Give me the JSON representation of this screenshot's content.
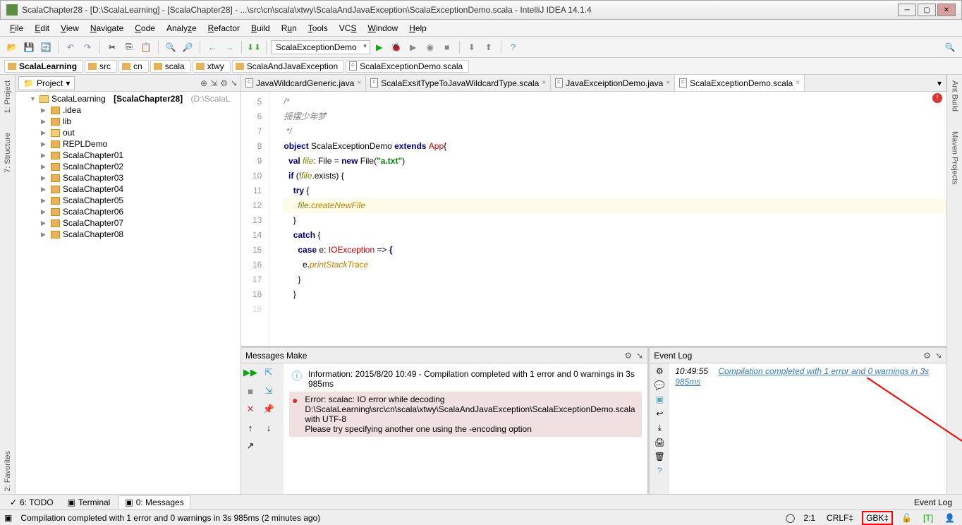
{
  "window": {
    "title": "ScalaChapter28 - [D:\\ScalaLearning] - [ScalaChapter28] - ...\\src\\cn\\scala\\xtwy\\ScalaAndJavaException\\ScalaExceptionDemo.scala - IntelliJ IDEA 14.1.4"
  },
  "menu": {
    "file": "File",
    "edit": "Edit",
    "view": "View",
    "navigate": "Navigate",
    "code": "Code",
    "analyze": "Analyze",
    "refactor": "Refactor",
    "build": "Build",
    "run": "Run",
    "tools": "Tools",
    "vcs": "VCS",
    "window": "Window",
    "help": "Help"
  },
  "toolbar": {
    "run_config": "ScalaExceptionDemo"
  },
  "breadcrumb": [
    "ScalaLearning",
    "src",
    "cn",
    "scala",
    "xtwy",
    "ScalaAndJavaException",
    "ScalaExceptionDemo.scala"
  ],
  "left_rail": {
    "project": "1: Project",
    "structure": "7: Structure",
    "favorites": "2: Favorites"
  },
  "right_rail": {
    "ant": "Ant Build",
    "maven": "Maven Projects"
  },
  "project_panel": {
    "header": "Project",
    "root": "ScalaLearning",
    "root_module": "[ScalaChapter28]",
    "root_path": "(D:\\ScalaL",
    "items": [
      ".idea",
      "lib",
      "out",
      "REPLDemo",
      "ScalaChapter01",
      "ScalaChapter02",
      "ScalaChapter03",
      "ScalaChapter04",
      "ScalaChapter05",
      "ScalaChapter06",
      "ScalaChapter07",
      "ScalaChapter08"
    ]
  },
  "editor_tabs": [
    "JavaWildcardGeneric.java",
    "ScalaExsitTypeToJavaWildcardType.scala",
    "JavaExceiptionDemo.java",
    "ScalaExceptionDemo.scala"
  ],
  "code_lines": {
    "start": 5,
    "content": [
      {
        "t": "com",
        "txt": "/*"
      },
      {
        "t": "com",
        "txt": "摇摆少年梦"
      },
      {
        "t": "com",
        "txt": " */"
      },
      {
        "t": "obj",
        "parts": [
          "object ",
          "ScalaExceptionDemo ",
          "extends ",
          "App",
          "{"
        ]
      },
      {
        "t": "val",
        "parts": [
          "  ",
          "val ",
          "file",
          ": File = ",
          "new ",
          "File(",
          "\"a.txt\"",
          ")"
        ]
      },
      {
        "t": "if",
        "parts": [
          "  ",
          "if ",
          "(!",
          "file",
          ".exists) {"
        ]
      },
      {
        "t": "try",
        "parts": [
          "    ",
          "try ",
          "{"
        ]
      },
      {
        "t": "call",
        "parts": [
          "      ",
          "file",
          ".",
          "createNewFile"
        ],
        "hl": true
      },
      {
        "t": "close",
        "txt": "    }"
      },
      {
        "t": "catch",
        "parts": [
          "    ",
          "catch ",
          "{"
        ]
      },
      {
        "t": "case",
        "parts": [
          "      ",
          "case ",
          "e: ",
          "IOException",
          " => ",
          "{"
        ]
      },
      {
        "t": "print",
        "parts": [
          "        e.",
          "printStackTrace"
        ]
      },
      {
        "t": "close",
        "txt": "      }"
      },
      {
        "t": "close",
        "txt": "    }"
      }
    ]
  },
  "messages": {
    "title": "Messages Make",
    "info": "Information: 2015/8/20 10:49 - Compilation completed with 1 error and 0 warnings in 3s 985ms",
    "error": "Error: scalac: IO error while decoding D:\\ScalaLearning\\src\\cn\\scala\\xtwy\\ScalaAndJavaException\\ScalaExceptionDemo.scala with UTF-8\nPlease try specifying another one using the -encoding option"
  },
  "eventlog": {
    "title": "Event Log",
    "time": "10:49:55",
    "link": "Compilation completed with 1 error and 0 warnings in 3s 985ms"
  },
  "bottom_tabs": {
    "todo": "6: TODO",
    "terminal": "Terminal",
    "messages": "0: Messages",
    "eventlog": "Event Log"
  },
  "status": {
    "msg": "Compilation completed with 1 error and 0 warnings in 3s 985ms (2 minutes ago)",
    "pos": "2:1",
    "sep": "CRLF",
    "enc": "GBK",
    "insp": "[T]"
  }
}
